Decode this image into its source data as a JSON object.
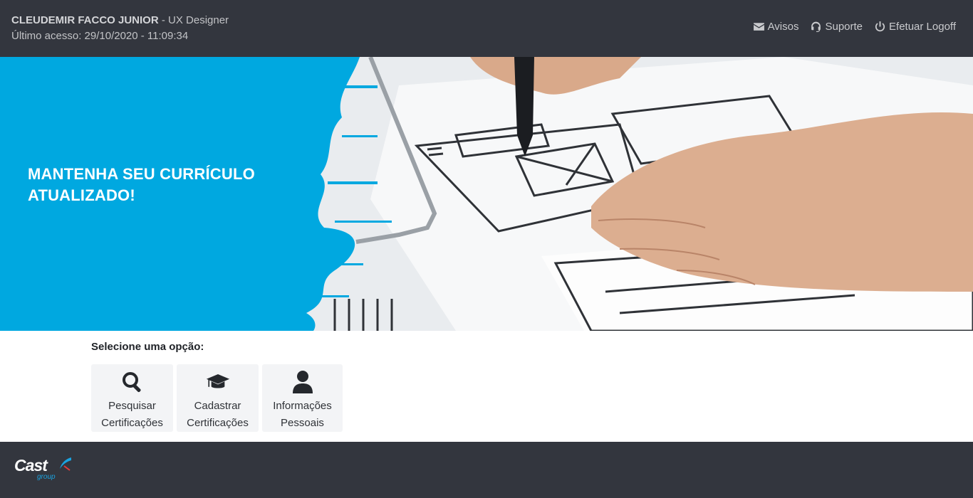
{
  "header": {
    "user_name": "CLEUDEMIR FACCO JUNIOR",
    "user_role": " - UX Designer",
    "last_access": "Último acesso: 29/10/2020 - 11:09:34",
    "nav": {
      "notices_label": "Avisos",
      "notices_icon": "envelope-icon",
      "support_label": "Suporte",
      "support_icon": "headset-icon",
      "logoff_label": "Efetuar Logoff",
      "logoff_icon": "power-icon"
    }
  },
  "hero": {
    "title": "MANTENHA SEU CURRÍCULO ATUALIZADO!",
    "accent_color": "#00a8e0"
  },
  "options": {
    "heading": "Selecione uma opção:",
    "tiles": [
      {
        "line1": "Pesquisar",
        "line2": "Certificações",
        "icon": "search-icon"
      },
      {
        "line1": "Cadastrar",
        "line2": "Certificações",
        "icon": "graduation-cap-icon"
      },
      {
        "line1": "Informações",
        "line2": "Pessoais",
        "icon": "user-icon"
      }
    ]
  },
  "footer": {
    "logo_main": "Cast",
    "logo_sub": "group"
  },
  "colors": {
    "bar_background": "#33363e",
    "tile_background": "#f3f4f6"
  }
}
